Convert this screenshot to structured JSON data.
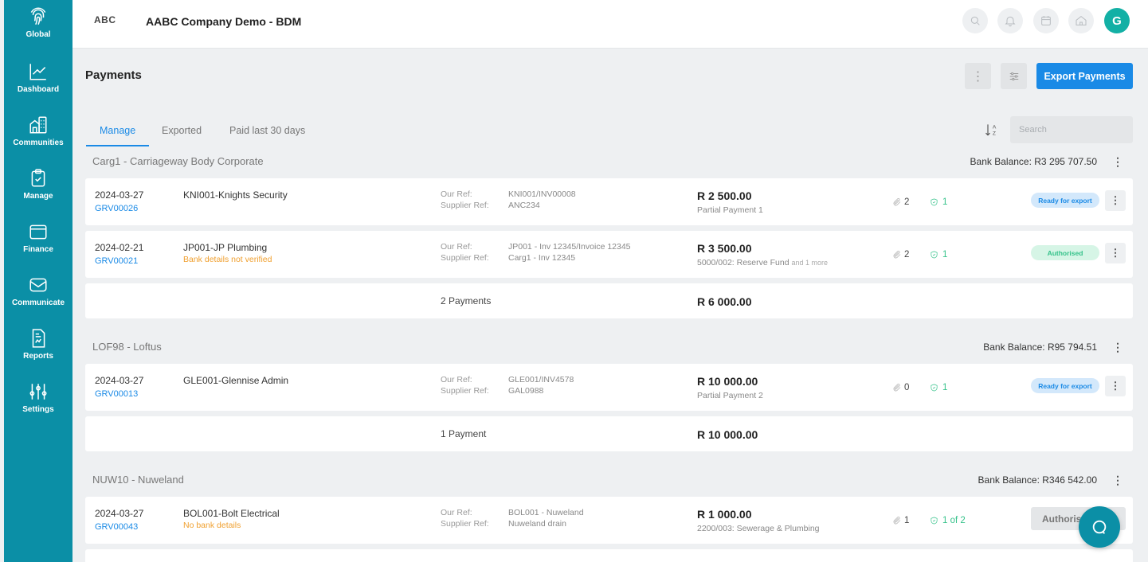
{
  "sidebar": {
    "items": [
      {
        "label": "Global",
        "icon": "fingerprint-icon"
      },
      {
        "label": "Dashboard",
        "icon": "chart-line-icon"
      },
      {
        "label": "Communities",
        "icon": "building-icon"
      },
      {
        "label": "Manage",
        "icon": "clipboard-check-icon"
      },
      {
        "label": "Finance",
        "icon": "wallet-icon"
      },
      {
        "label": "Communicate",
        "icon": "mail-icon"
      },
      {
        "label": "Reports",
        "icon": "report-icon"
      },
      {
        "label": "Settings",
        "icon": "sliders-icon"
      }
    ]
  },
  "header": {
    "logo_text": "ABC",
    "company": "AABC Company Demo - BDM",
    "avatar_initial": "G"
  },
  "page": {
    "title": "Payments",
    "export_label": "Export Payments"
  },
  "tabs": [
    {
      "label": "Manage"
    },
    {
      "label": "Exported"
    },
    {
      "label": "Paid last 30 days"
    }
  ],
  "search": {
    "placeholder": "Search"
  },
  "groups": [
    {
      "title": "Carg1 - Carriageway Body Corporate",
      "bank_balance": "Bank Balance: R3 295 707.50",
      "payments": [
        {
          "date": "2024-03-27",
          "grv": "GRV00026",
          "supplier": "KNI001-Knights Security",
          "warning": "",
          "our_ref_label": "Our Ref:",
          "our_ref": "KNI001/INV00008",
          "supplier_ref_label": "Supplier Ref:",
          "supplier_ref": "ANC234",
          "amount": "R 2 500.00",
          "amount_note": "Partial Payment 1",
          "more": "",
          "attachments": "2",
          "approvals": "1",
          "status": "Ready for export"
        },
        {
          "date": "2024-02-21",
          "grv": "GRV00021",
          "supplier": "JP001-JP Plumbing",
          "warning": "Bank details not verified",
          "our_ref_label": "Our Ref:",
          "our_ref": "JP001 - Inv 12345/Invoice 12345",
          "supplier_ref_label": "Supplier Ref:",
          "supplier_ref": "Carg1 - Inv 12345",
          "amount": "R 3 500.00",
          "amount_note": "5000/002: Reserve Fund",
          "more": "and 1 more",
          "attachments": "2",
          "approvals": "1",
          "status": "Authorised"
        }
      ],
      "summary_count": "2 Payments",
      "summary_amount": "R 6 000.00"
    },
    {
      "title": "LOF98 - Loftus",
      "bank_balance": "Bank Balance: R95 794.51",
      "payments": [
        {
          "date": "2024-03-27",
          "grv": "GRV00013",
          "supplier": "GLE001-Glennise Admin",
          "warning": "",
          "our_ref_label": "Our Ref:",
          "our_ref": "GLE001/INV4578",
          "supplier_ref_label": "Supplier Ref:",
          "supplier_ref": "GAL0988",
          "amount": "R 10 000.00",
          "amount_note": "Partial Payment 2",
          "more": "",
          "attachments": "0",
          "approvals": "1",
          "status": "Ready for export"
        }
      ],
      "summary_count": "1 Payment",
      "summary_amount": "R 10 000.00"
    },
    {
      "title": "NUW10 - Nuweland",
      "bank_balance": "Bank Balance: R346 542.00",
      "payments": [
        {
          "date": "2024-03-27",
          "grv": "GRV00043",
          "supplier": "BOL001-Bolt Electrical",
          "warning": "No bank details",
          "our_ref_label": "Our Ref:",
          "our_ref": "BOL001 - Nuweland",
          "supplier_ref_label": "Supplier Ref:",
          "supplier_ref": "Nuweland drain",
          "amount": "R 1 000.00",
          "amount_note": "2200/003: Sewerage & Plumbing",
          "more": "",
          "attachments": "1",
          "approvals": "1 of 2",
          "status": "Authorise"
        }
      ]
    }
  ],
  "colors": {
    "sidebar": "#0b8fa6",
    "accent": "#1a8ae6",
    "success": "#35c28a",
    "warning": "#f0a030"
  }
}
